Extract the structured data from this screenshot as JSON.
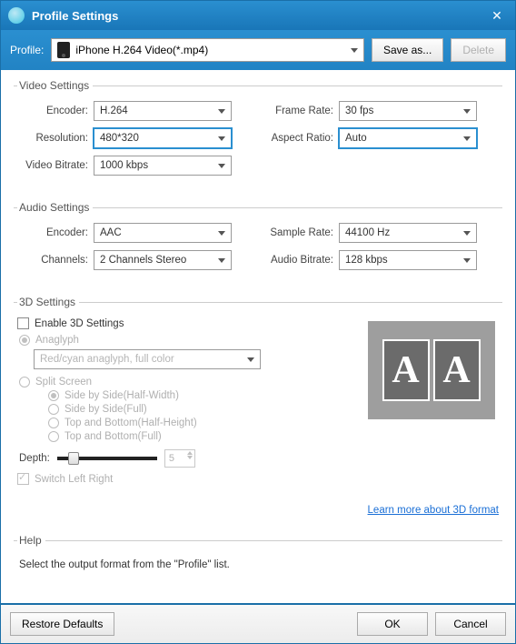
{
  "title": "Profile Settings",
  "profile_label": "Profile:",
  "profile_value": "iPhone H.264 Video(*.mp4)",
  "save_as": "Save as...",
  "delete": "Delete",
  "sections": {
    "video": {
      "legend": "Video Settings",
      "encoder_label": "Encoder:",
      "encoder": "H.264",
      "resolution_label": "Resolution:",
      "resolution": "480*320",
      "bitrate_label": "Video Bitrate:",
      "bitrate": "1000 kbps",
      "framerate_label": "Frame Rate:",
      "framerate": "30 fps",
      "aspect_label": "Aspect Ratio:",
      "aspect": "Auto"
    },
    "audio": {
      "legend": "Audio Settings",
      "encoder_label": "Encoder:",
      "encoder": "AAC",
      "channels_label": "Channels:",
      "channels": "2 Channels Stereo",
      "samplerate_label": "Sample Rate:",
      "samplerate": "44100 Hz",
      "bitrate_label": "Audio Bitrate:",
      "bitrate": "128 kbps"
    },
    "threeD": {
      "legend": "3D Settings",
      "enable": "Enable 3D Settings",
      "anaglyph": "Anaglyph",
      "anaglyph_mode": "Red/cyan anaglyph, full color",
      "split": "Split Screen",
      "sbs_half": "Side by Side(Half-Width)",
      "sbs_full": "Side by Side(Full)",
      "tb_half": "Top and Bottom(Half-Height)",
      "tb_full": "Top and Bottom(Full)",
      "depth_label": "Depth:",
      "depth_value": "5",
      "switch_lr": "Switch Left Right",
      "learn_more": "Learn more about 3D format"
    },
    "help": {
      "legend": "Help",
      "text": "Select the output format from the \"Profile\" list."
    }
  },
  "footer": {
    "restore": "Restore Defaults",
    "ok": "OK",
    "cancel": "Cancel"
  }
}
